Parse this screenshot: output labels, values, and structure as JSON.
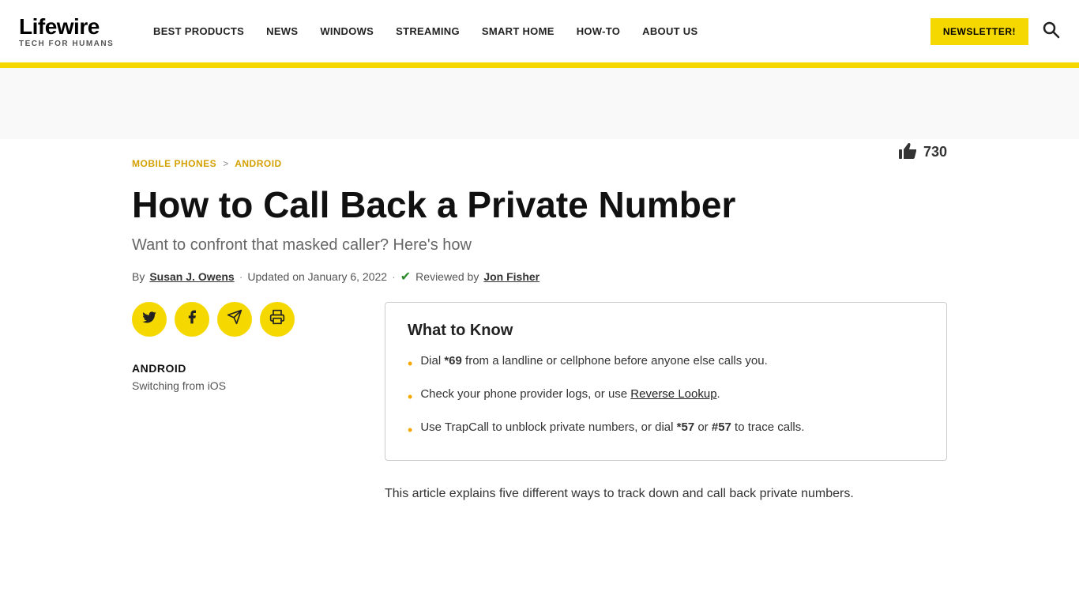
{
  "header": {
    "logo_text": "Lifewire",
    "logo_tagline": "TECH FOR HUMANS",
    "nav_items": [
      {
        "label": "BEST PRODUCTS",
        "href": "#"
      },
      {
        "label": "NEWS",
        "href": "#"
      },
      {
        "label": "WINDOWS",
        "href": "#"
      },
      {
        "label": "STREAMING",
        "href": "#"
      },
      {
        "label": "SMART HOME",
        "href": "#"
      },
      {
        "label": "HOW-TO",
        "href": "#"
      },
      {
        "label": "ABOUT US",
        "href": "#"
      }
    ],
    "newsletter_btn": "NEWSLETTER!",
    "search_aria": "Search"
  },
  "breadcrumb": {
    "parent": "MOBILE PHONES",
    "separator": ">",
    "current": "ANDROID"
  },
  "article": {
    "vote_count": "730",
    "title": "How to Call Back a Private Number",
    "subtitle": "Want to confront that masked caller? Here's how",
    "by_label": "By",
    "author": "Susan J. Owens",
    "updated_label": "Updated on January 6, 2022",
    "reviewed_label": "Reviewed by",
    "reviewer": "Jon Fisher"
  },
  "sidebar": {
    "category": "ANDROID",
    "link_text": "Switching from iOS"
  },
  "what_to_know": {
    "title": "What to Know",
    "items": [
      {
        "text_before": "Dial ",
        "bold": "*69",
        "text_after": " from a landline or cellphone before anyone else calls you.",
        "has_link": false
      },
      {
        "text_before": "Check your phone provider logs, or use ",
        "link_text": "Reverse Lookup",
        "text_after": ".",
        "has_link": true
      },
      {
        "text_before": "Use TrapCall to unblock private numbers, or dial ",
        "bold1": "*57",
        "text_middle": " or ",
        "bold2": "#57",
        "text_after": " to trace calls.",
        "has_link": false,
        "type": "double_bold"
      }
    ]
  },
  "article_body": {
    "intro": "This article explains five different ways to track down and call back private numbers."
  },
  "social": {
    "twitter": "𝕏",
    "facebook": "f",
    "telegram": "✈",
    "print": "🖨"
  },
  "colors": {
    "accent_yellow": "#f5d800",
    "link_gold": "#d4a000",
    "bullet_orange": "#f5a800"
  }
}
